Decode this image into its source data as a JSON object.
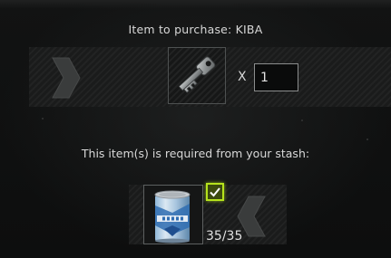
{
  "purchase": {
    "title": "Item to purchase: KIBA",
    "item_icon": "key-icon",
    "multiplier_label": "X",
    "quantity": "1"
  },
  "requirements": {
    "label": "This item(s) is required from your stash:",
    "items": [
      {
        "icon": "condensed-milk-can-icon",
        "count": "35/35",
        "fulfilled": true
      }
    ]
  },
  "colors": {
    "check_border": "#b5e21c",
    "text": "#d8d8d8"
  }
}
